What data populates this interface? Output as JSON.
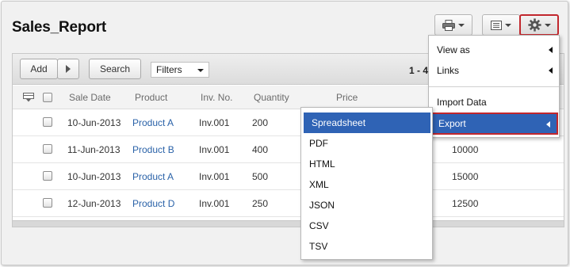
{
  "page": {
    "title": "Sales_Report"
  },
  "header_buttons": {
    "print_icon": "printer-icon",
    "view_icon": "list-view-icon",
    "settings_icon": "gear-icon"
  },
  "toolbar": {
    "add_label": "Add",
    "search_label": "Search",
    "filter_selected": "Filters",
    "pager_text": "1 - 4"
  },
  "table": {
    "columns": [
      "Sale Date",
      "Product",
      "Inv. No.",
      "Quantity",
      "Price"
    ],
    "rows": [
      {
        "date": "10-Jun-2013",
        "product": "Product A",
        "inv": "Inv.001",
        "qty": "200",
        "total": ""
      },
      {
        "date": "11-Jun-2013",
        "product": "Product B",
        "inv": "Inv.001",
        "qty": "400",
        "total": "10000"
      },
      {
        "date": "10-Jun-2013",
        "product": "Product A",
        "inv": "Inv.001",
        "qty": "500",
        "total": "15000"
      },
      {
        "date": "12-Jun-2013",
        "product": "Product D",
        "inv": "Inv.001",
        "qty": "250",
        "total": "12500"
      }
    ]
  },
  "settings_menu": {
    "items": [
      "View as",
      "Links",
      "Import Data",
      "Export"
    ]
  },
  "export_menu": {
    "items": [
      "Spreadsheet",
      "PDF",
      "HTML",
      "XML",
      "JSON",
      "CSV",
      "TSV"
    ]
  },
  "colors": {
    "accent": "#2f63b5",
    "highlight_outline": "#c1272d",
    "link": "#2a62a8"
  }
}
